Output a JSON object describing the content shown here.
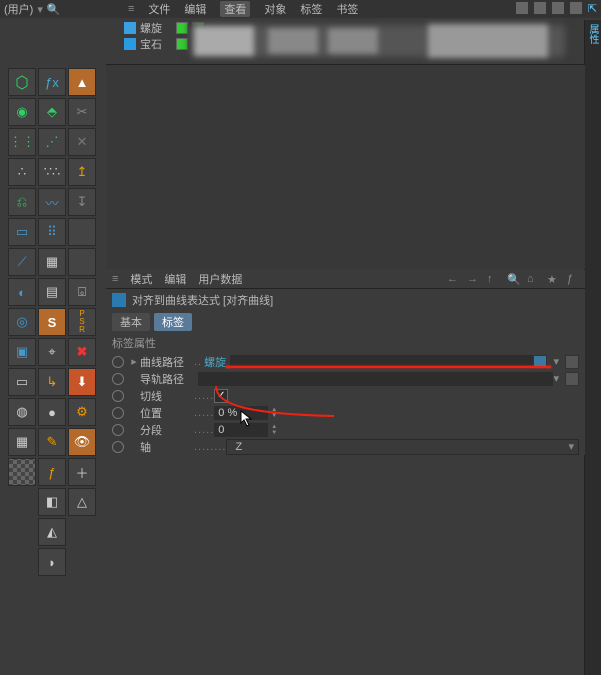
{
  "top": {
    "layout_label": "(用户)",
    "menus": [
      "文件",
      "编辑",
      "查看",
      "对象",
      "标签",
      "书签"
    ],
    "highlighted_menu_index": 2
  },
  "hierarchy": {
    "items": [
      {
        "icon": "helix",
        "name": "螺旋",
        "vis_editor": "on",
        "vis_render": "on",
        "tags": []
      },
      {
        "icon": "gem",
        "name": "宝石",
        "vis_editor": "on",
        "vis_render": "on",
        "tags": [
          "align-to-spline-tag"
        ]
      }
    ]
  },
  "attr_panel": {
    "menu": [
      "模式",
      "编辑",
      "用户数据"
    ],
    "nav_icons": [
      "back-icon",
      "forward-icon",
      "up-icon",
      "search-icon",
      "home-icon",
      "bookmark-icon",
      "fn-icon"
    ],
    "side_tab": "属性",
    "title_icon": "align-to-spline-icon",
    "title": "对齐到曲线表达式 [对齐曲线]",
    "tabs": [
      "基本",
      "标签"
    ],
    "active_tab_index": 1,
    "section_header": "标签属性",
    "props": {
      "curve_path": {
        "label": "曲线路径",
        "value_link": "螺旋"
      },
      "rail_path": {
        "label": "导轨路径",
        "value": ""
      },
      "tangent": {
        "label": "切线",
        "checked": true
      },
      "position": {
        "label": "位置",
        "value": "0 %"
      },
      "segment": {
        "label": "分段",
        "value": "0"
      },
      "axis": {
        "label": "轴",
        "value": "Z"
      }
    }
  },
  "left_tools": {
    "col1": [
      "cube-icon",
      "lathe-icon",
      "array-linear-icon",
      "cloner-icon",
      "symmetry-icon",
      "effector-icon",
      "spline-pen-icon",
      "deformer-icon",
      "light-icon",
      "camera-icon",
      "floor-icon",
      "material-ball-icon",
      "render-icon",
      "checker-icon"
    ],
    "col2": [
      "function-icon",
      "bevel-icon",
      "array-grid-icon",
      "random-icon",
      "spline-icon",
      "points-icon",
      "grid-icon",
      "uv-icon",
      "letter-s-icon",
      "coords-icon",
      "axis-tool-icon",
      "sphere-icon",
      "brush-icon",
      "script-icon",
      "color-icon",
      "cone-icon",
      "blend-icon"
    ],
    "col3": [
      "extrude-icon",
      "knife-icon",
      "disable-icon",
      "move-up-icon",
      "move-down-icon",
      "empty-icon",
      "empty-icon",
      "frame-icon",
      "psr-icon",
      "close-x-icon",
      "down-arrow-icon",
      "settings-icon",
      "eye-icon",
      "plus-small-icon",
      "triangle-icon"
    ]
  }
}
